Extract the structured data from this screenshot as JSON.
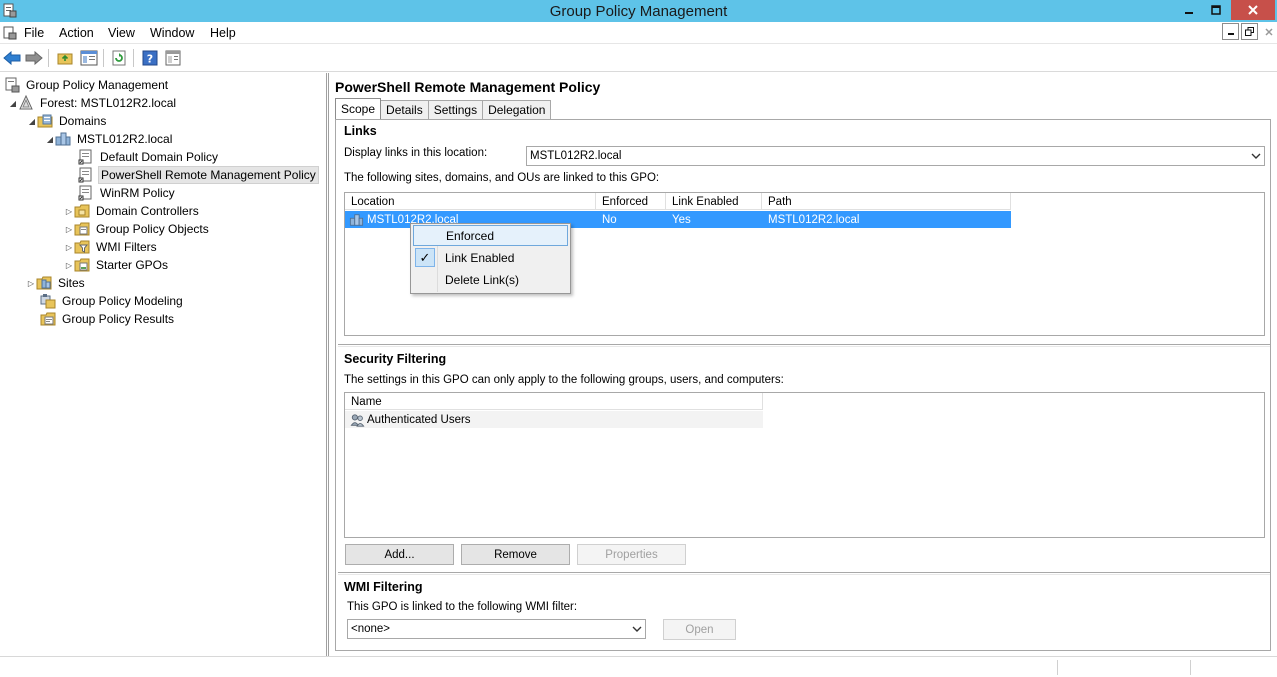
{
  "window": {
    "title": "Group Policy Management",
    "minimize_icon": "minimize-icon",
    "maximize_icon": "restore-icon",
    "close_icon": "close-icon"
  },
  "menu": {
    "items": [
      "File",
      "Action",
      "View",
      "Window",
      "Help"
    ]
  },
  "toolbar": {
    "icons": [
      "back-arrow-icon",
      "forward-arrow-icon",
      "folder-up-icon",
      "show-hide-tree-icon",
      "refresh-icon",
      "help-icon",
      "properties-icon"
    ]
  },
  "tree": {
    "items": [
      {
        "label": "Group Policy Management",
        "icon": "gpm-root-icon",
        "expander": ""
      },
      {
        "label": "Forest: MSTL012R2.local",
        "icon": "forest-icon",
        "expander": "◢"
      },
      {
        "label": "Domains",
        "icon": "domains-folder-icon",
        "expander": "◢"
      },
      {
        "label": "MSTL012R2.local",
        "icon": "domain-icon",
        "expander": "◢"
      },
      {
        "label": "Default Domain Policy",
        "icon": "gpo-link-icon",
        "expander": ""
      },
      {
        "label": "PowerShell Remote Management Policy",
        "icon": "gpo-link-icon",
        "expander": ""
      },
      {
        "label": "WinRM Policy",
        "icon": "gpo-link-icon",
        "expander": ""
      },
      {
        "label": "Domain Controllers",
        "icon": "ou-folder-icon",
        "expander": "▷"
      },
      {
        "label": "Group Policy Objects",
        "icon": "gpo-folder-icon",
        "expander": "▷"
      },
      {
        "label": "WMI Filters",
        "icon": "wmi-folder-icon",
        "expander": "▷"
      },
      {
        "label": "Starter GPOs",
        "icon": "starter-folder-icon",
        "expander": "▷"
      },
      {
        "label": "Sites",
        "icon": "sites-folder-icon",
        "expander": "▷"
      },
      {
        "label": "Group Policy Modeling",
        "icon": "modeling-icon",
        "expander": ""
      },
      {
        "label": "Group Policy Results",
        "icon": "results-icon",
        "expander": ""
      }
    ]
  },
  "panel": {
    "title": "PowerShell Remote Management Policy",
    "tabs": [
      "Scope",
      "Details",
      "Settings",
      "Delegation"
    ],
    "links": {
      "heading": "Links",
      "display_label": "Display links in this location:",
      "display_value": "MSTL012R2.local",
      "description": "The following sites, domains, and OUs are linked to this GPO:",
      "columns": [
        "Location",
        "Enforced",
        "Link Enabled",
        "Path"
      ],
      "rows": [
        {
          "location": "MSTL012R2.local",
          "enforced": "No",
          "link_enabled": "Yes",
          "path": "MSTL012R2.local"
        }
      ]
    },
    "context_menu": {
      "items": [
        "Enforced",
        "Link Enabled",
        "Delete Link(s)"
      ],
      "checkmark": "✓"
    },
    "security": {
      "heading": "Security Filtering",
      "description": "The settings in this GPO can only apply to the following groups, users, and computers:",
      "columns": [
        "Name"
      ],
      "rows": [
        "Authenticated Users"
      ],
      "buttons": {
        "add": "Add...",
        "remove": "Remove",
        "properties": "Properties"
      }
    },
    "wmi": {
      "heading": "WMI Filtering",
      "description": "This GPO is linked to the following WMI filter:",
      "value": "<none>",
      "open_label": "Open"
    }
  },
  "colors": {
    "titlebar": "#5ec3e8",
    "close_button": "#c7504a",
    "selection": "#3399ff"
  }
}
